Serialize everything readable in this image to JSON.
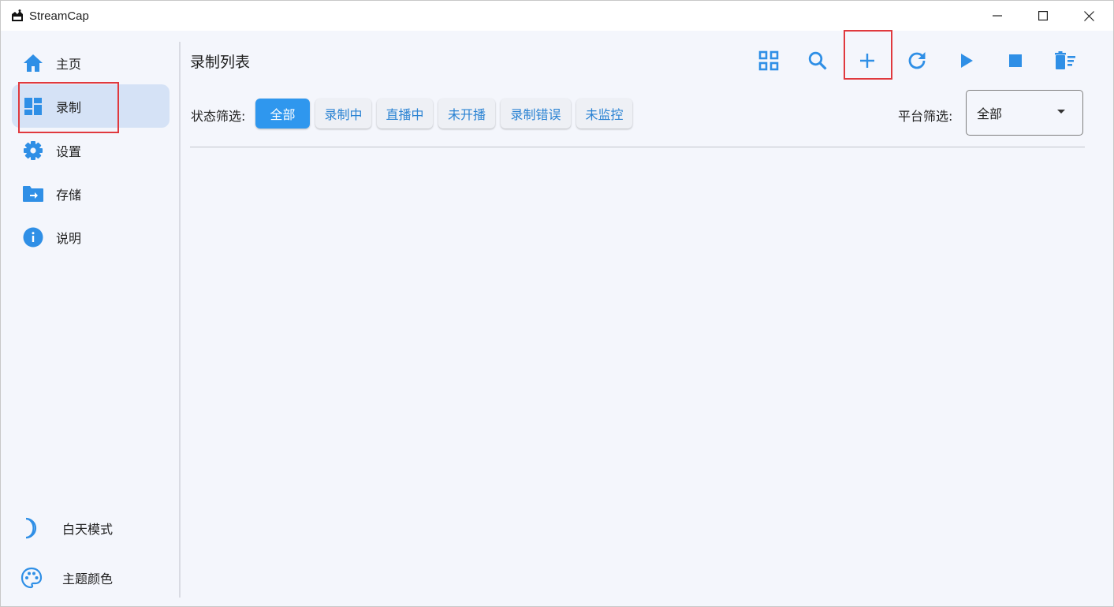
{
  "window": {
    "title": "StreamCap",
    "controls": [
      "minimize-icon",
      "maximize-icon",
      "close-icon"
    ]
  },
  "sidebar": {
    "items": [
      {
        "label": "主页",
        "icon": "home-icon"
      },
      {
        "label": "录制",
        "icon": "dashboard-icon",
        "active": true
      },
      {
        "label": "设置",
        "icon": "gear-icon"
      },
      {
        "label": "存储",
        "icon": "folder-icon"
      },
      {
        "label": "说明",
        "icon": "info-icon"
      }
    ],
    "bottom": [
      {
        "label": "白天模式",
        "icon": "moon-icon"
      },
      {
        "label": "主题颜色",
        "icon": "palette-icon"
      }
    ]
  },
  "main": {
    "title": "录制列表",
    "toolbar": [
      "grid-view-icon",
      "search-icon",
      "add-icon",
      "refresh-icon",
      "play-icon",
      "stop-icon",
      "delete-all-icon"
    ],
    "status_filter": {
      "label": "状态筛选:",
      "options": [
        "全部",
        "录制中",
        "直播中",
        "未开播",
        "录制错误",
        "未监控"
      ],
      "selected": "全部"
    },
    "platform_filter": {
      "label": "平台筛选:",
      "value": "全部"
    }
  },
  "colors": {
    "accent": "#2f97ee",
    "icon": "#2f8fe6",
    "highlight": "#e0393e",
    "nav_active_bg": "#d5e2f6"
  }
}
